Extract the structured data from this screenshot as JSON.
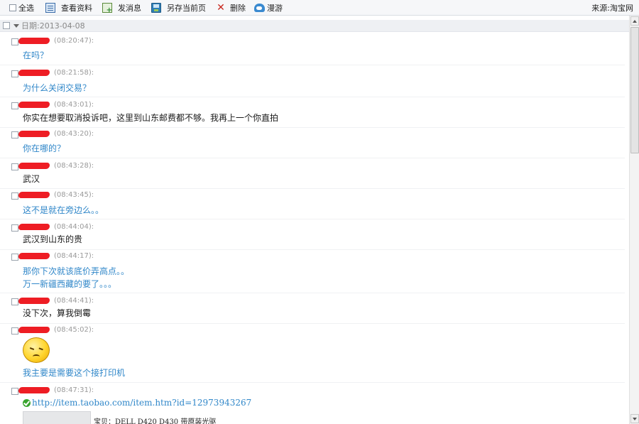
{
  "toolbar": {
    "select_all": "全选",
    "view_profile": "查看资料",
    "send_message": "发消息",
    "save_page": "另存当前页",
    "delete": "删除",
    "roam": "漫游",
    "source": "来源:淘宝网"
  },
  "date_header": "日期:2013-04-08",
  "messages": [
    {
      "time": "(08:20:47):",
      "lines": [
        "在吗？"
      ],
      "color": "#3087c9"
    },
    {
      "time": "(08:21:58):",
      "lines": [
        "为什么关闭交易？"
      ],
      "color": "#3087c9"
    },
    {
      "time": "(08:43:01):",
      "lines": [
        "你实在想要取消投诉吧，这里到山东邮费都不够。我再上一个你直拍"
      ],
      "color": "#1a1a1a"
    },
    {
      "time": "(08:43:20):",
      "lines": [
        "你在哪的？"
      ],
      "color": "#3087c9"
    },
    {
      "time": "(08:43:28):",
      "lines": [
        "武汉"
      ],
      "color": "#1a1a1a"
    },
    {
      "time": "(08:43:45):",
      "lines": [
        "这不是就在旁边么。。"
      ],
      "color": "#3087c9"
    },
    {
      "time": "(08:44:04):",
      "lines": [
        "武汉到山东的贵"
      ],
      "color": "#1a1a1a"
    },
    {
      "time": "(08:44:17):",
      "lines": [
        "那你下次就该底价弄高点。。",
        "万一新疆西藏的要了。。。"
      ],
      "color": "#3087c9"
    },
    {
      "time": "(08:44:41):",
      "lines": [
        "没下次，算我倒霉"
      ],
      "color": "#1a1a1a"
    },
    {
      "time": "(08:45:02):",
      "lines": [
        "我主要是需要这个接打印机"
      ],
      "color": "#3087c9"
    },
    {
      "time": "(08:47:31):",
      "lines": [],
      "color": "#1a1a1a"
    }
  ],
  "link": {
    "url": "http://item.taobao.com/item.htm?id=12973943267",
    "product": "宝贝：DELL D420 D430  带原装光驱"
  },
  "icons": [
    "checkbox-icon",
    "profile-icon",
    "send-message-icon",
    "save-page-icon",
    "delete-icon",
    "cloud-roam-icon",
    "collapse-triangle-icon",
    "emoji-icon",
    "check-mark-icon"
  ]
}
